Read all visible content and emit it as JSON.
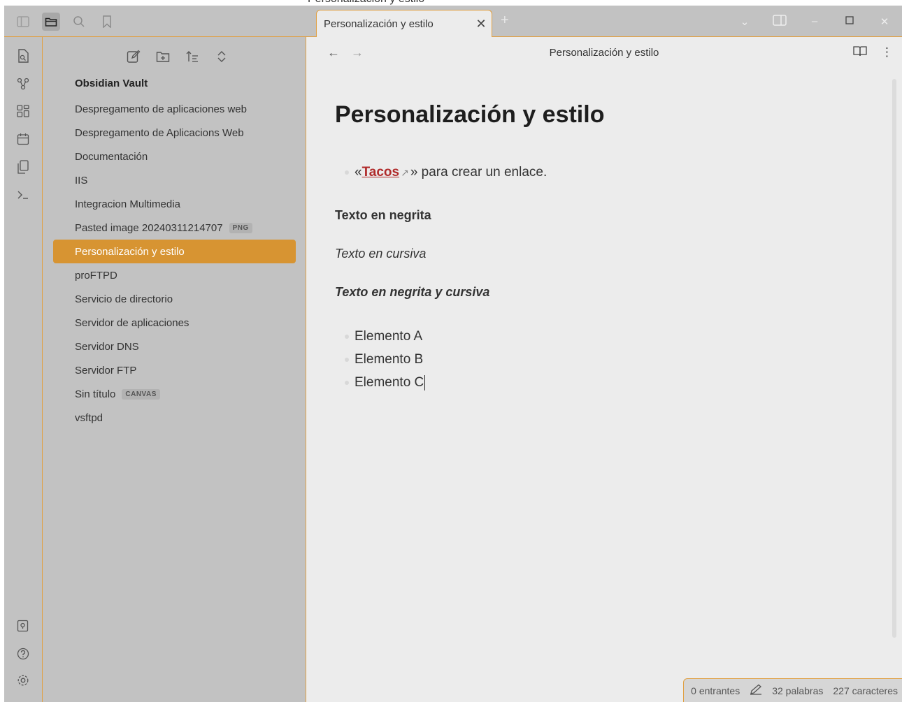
{
  "window": {
    "title": "Personalización y estilo"
  },
  "tabs": [
    {
      "label": "Personalización y estilo",
      "close": "✕"
    }
  ],
  "tab_add": "+",
  "sidebar": {
    "vault_name": "Obsidian Vault",
    "files": [
      {
        "label": "Despregamento de aplicaciones web",
        "badge": ""
      },
      {
        "label": "Despregamento de Aplicacions Web",
        "badge": ""
      },
      {
        "label": "Documentación",
        "badge": ""
      },
      {
        "label": "IIS",
        "badge": ""
      },
      {
        "label": "Integracion Multimedia",
        "badge": ""
      },
      {
        "label": "Pasted image 20240311214707",
        "badge": "PNG"
      },
      {
        "label": "Personalización y estilo",
        "badge": "",
        "active": true
      },
      {
        "label": "proFTPD",
        "badge": ""
      },
      {
        "label": "Servicio de directorio",
        "badge": ""
      },
      {
        "label": "Servidor de aplicaciones",
        "badge": ""
      },
      {
        "label": "Servidor DNS",
        "badge": ""
      },
      {
        "label": "Servidor FTP",
        "badge": ""
      },
      {
        "label": "Sin título",
        "badge": "CANVAS"
      },
      {
        "label": "vsftpd",
        "badge": ""
      }
    ]
  },
  "editor": {
    "nav_title": "Personalización y estilo",
    "heading": "Personalización y estilo",
    "link_prefix": "«",
    "link_text": "Tacos",
    "link_suffix": "» para crear un enlace.",
    "bold_text": "Texto en negrita",
    "italic_text": "Texto en cursiva",
    "bold_italic_text": "Texto en negrita y cursiva",
    "list_items": [
      "Elemento A",
      "Elemento B",
      "Elemento C"
    ]
  },
  "status": {
    "backlinks": "0 entrantes",
    "words": "32 palabras",
    "chars": "227 caracteres"
  },
  "colors": {
    "accent": "#d79432",
    "border": "#e0a043",
    "link": "#b02a2a"
  }
}
